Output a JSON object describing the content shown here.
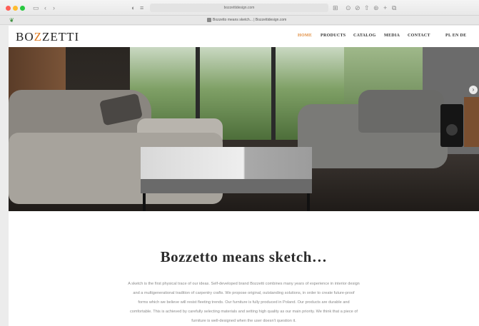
{
  "browser": {
    "url": "bozzettidesign.com",
    "tab_title": "Bozzetto means sketch... | Bozzettidesign.com",
    "nav_back": "‹",
    "nav_forward": "›"
  },
  "header": {
    "logo_prefix": "BO",
    "logo_accent": "Z",
    "logo_suffix": "ZETTI",
    "nav": [
      {
        "label": "HOME",
        "active": true
      },
      {
        "label": "PRODUCTS",
        "active": false
      },
      {
        "label": "CATALOG",
        "active": false
      },
      {
        "label": "MEDIA",
        "active": false
      },
      {
        "label": "CONTACT",
        "active": false
      }
    ],
    "languages": "PL EN DE"
  },
  "hero": {
    "next_arrow": "›"
  },
  "main": {
    "headline": "Bozzetto means sketch…",
    "body_lines": [
      "A sketch is the first physical trace of our ideas. Self-developed brand Bozzetti combines many years of experience in interior design",
      "and a multigenerational tradition of carpentry crafts. We propose original, outstanding solutions, in order to create future-proof",
      "forms which we believe will resist fleeting trends. Our furniture is fully produced in Poland. Our products are durable and",
      "comfortable. This is achieved by carefully selecting materials and setting high quality as our main priority. We think that a piece of",
      "furniture is well-designed when the user doesn't question it."
    ]
  },
  "colors": {
    "accent": "#e07a1f",
    "nav_active": "#e08a3a"
  }
}
